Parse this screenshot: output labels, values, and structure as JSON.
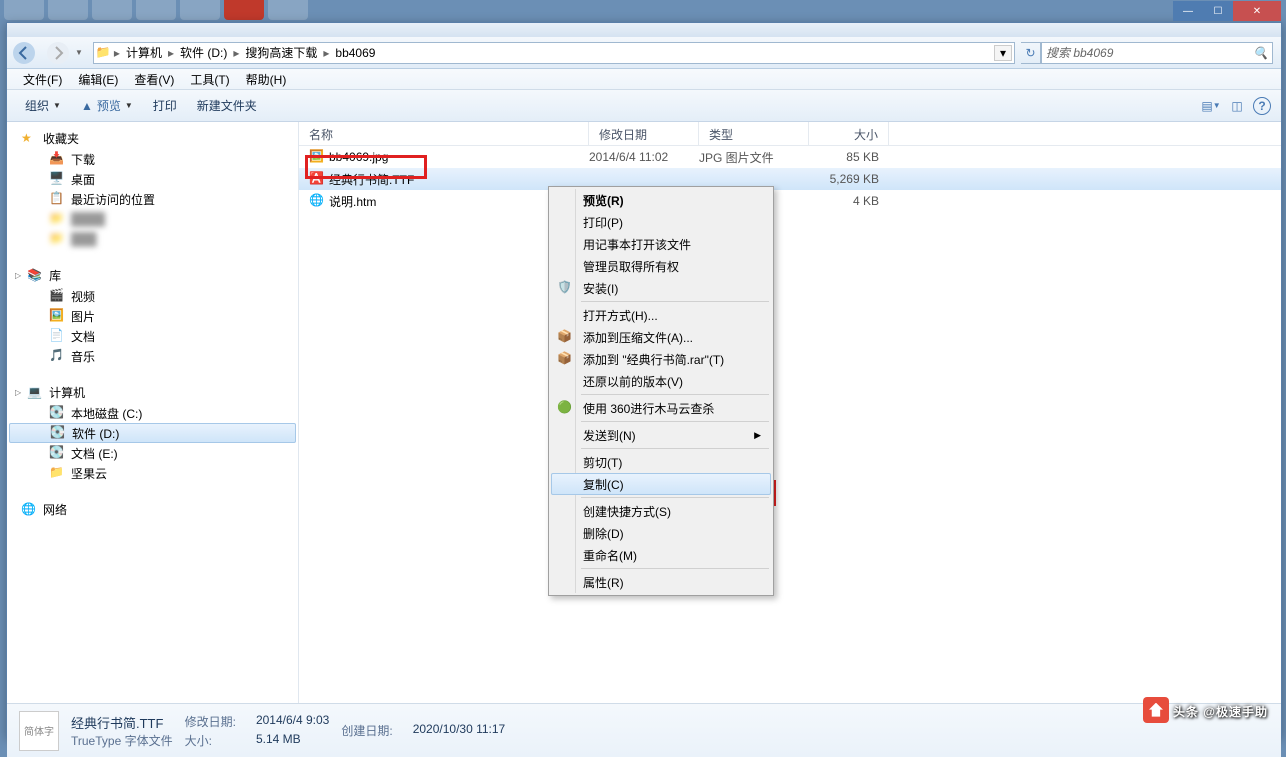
{
  "path": {
    "segs": [
      "计算机",
      "软件 (D:)",
      "搜狗高速下载",
      "bb4069"
    ]
  },
  "search": {
    "placeholder": "搜索 bb4069"
  },
  "menubar": [
    "文件(F)",
    "编辑(E)",
    "查看(V)",
    "工具(T)",
    "帮助(H)"
  ],
  "toolbar": {
    "org": "组织",
    "preview": "预览",
    "print": "打印",
    "newfolder": "新建文件夹"
  },
  "sidebar": {
    "fav": {
      "head": "收藏夹",
      "items": [
        "下载",
        "桌面",
        "最近访问的位置"
      ]
    },
    "lib": {
      "head": "库",
      "items": [
        "视频",
        "图片",
        "文档",
        "音乐"
      ]
    },
    "comp": {
      "head": "计算机",
      "items": [
        "本地磁盘 (C:)",
        "软件 (D:)",
        "文档 (E:)",
        "坚果云"
      ]
    },
    "net": {
      "head": "网络"
    }
  },
  "columns": {
    "name": "名称",
    "date": "修改日期",
    "type": "类型",
    "size": "大小"
  },
  "files": [
    {
      "name": "bb4069.jpg",
      "date": "2014/6/4 11:02",
      "type": "JPG 图片文件",
      "size": "85 KB",
      "ico": "img"
    },
    {
      "name": "经典行书简.TTF",
      "date": "",
      "type": "",
      "size": "5,269 KB",
      "ico": "ttf"
    },
    {
      "name": "说明.htm",
      "date": "",
      "type": "",
      "size": "4 KB",
      "ico": "htm"
    }
  ],
  "ctx": {
    "preview": "预览(R)",
    "print": "打印(P)",
    "notepad": "用记事本打开该文件",
    "admin": "管理员取得所有权",
    "install": "安装(I)",
    "openwith": "打开方式(H)...",
    "addzip": "添加到压缩文件(A)...",
    "addrar": "添加到 \"经典行书简.rar\"(T)",
    "restore": "还原以前的版本(V)",
    "scan": "使用 360进行木马云查杀",
    "sendto": "发送到(N)",
    "cut": "剪切(T)",
    "copy": "复制(C)",
    "shortcut": "创建快捷方式(S)",
    "delete": "删除(D)",
    "rename": "重命名(M)",
    "props": "属性(R)"
  },
  "details": {
    "name": "经典行书简.TTF",
    "type": "TrueType 字体文件",
    "mdate_lb": "修改日期:",
    "mdate": "2014/6/4 9:03",
    "cdate_lb": "创建日期:",
    "cdate": "2020/10/30 11:17",
    "size_lb": "大小:",
    "size": "5.14 MB",
    "thumb": "简体字"
  },
  "watermark": "头条 @极速手助"
}
